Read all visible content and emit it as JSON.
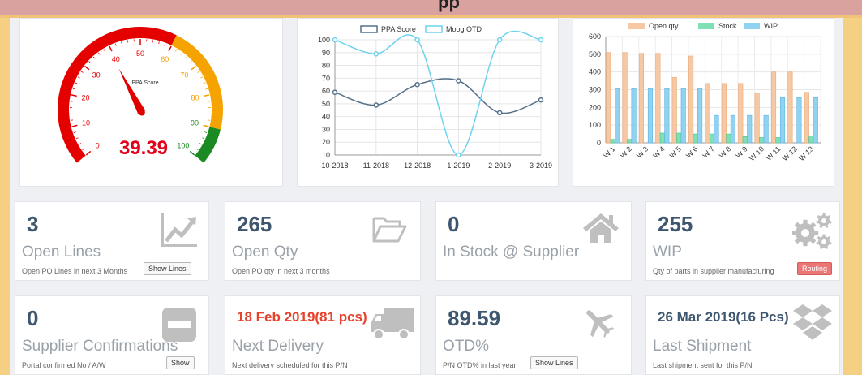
{
  "header": {
    "title": "pp"
  },
  "gauge": {
    "value": "39.39",
    "label": "PPA Score",
    "ticks": [
      "0",
      "10",
      "20",
      "30",
      "40",
      "50",
      "60",
      "70",
      "80",
      "90",
      "100"
    ]
  },
  "line_chart": {
    "legend": [
      "PPA Score",
      "Moog OTD"
    ],
    "yticks": [
      "100",
      "90",
      "80",
      "70",
      "60",
      "50",
      "40",
      "30",
      "20",
      "10"
    ],
    "xticks": [
      "10-2018",
      "11-2018",
      "12-2018",
      "1-2019",
      "2-2019",
      "3-2019"
    ]
  },
  "bar_chart": {
    "legend": [
      "Open qty",
      "Stock",
      "WIP"
    ],
    "yticks": [
      "600",
      "500",
      "400",
      "300",
      "200",
      "100",
      "0"
    ],
    "xticks": [
      "W 1",
      "W 2",
      "W 3",
      "W 4",
      "W 5",
      "W 6",
      "W 7",
      "W 8",
      "W 9",
      "W 10",
      "W 11",
      "W 12",
      "W 13"
    ]
  },
  "chart_data": [
    {
      "type": "gauge",
      "title": "PPA Score",
      "value": 39.39,
      "range": [
        0,
        100
      ],
      "bands": [
        {
          "from": 0,
          "to": 60,
          "color": "#e50000"
        },
        {
          "from": 60,
          "to": 90,
          "color": "#f5a300"
        },
        {
          "from": 90,
          "to": 100,
          "color": "#1b8a23"
        }
      ]
    },
    {
      "type": "line",
      "categories": [
        "10-2018",
        "11-2018",
        "12-2018",
        "1-2019",
        "2-2019",
        "3-2019"
      ],
      "series": [
        {
          "name": "PPA Score",
          "color": "#56708a",
          "values": [
            59,
            49,
            65,
            68,
            43,
            53
          ]
        },
        {
          "name": "Moog OTD",
          "color": "#6dd3ee",
          "values": [
            100,
            89,
            100,
            10,
            100,
            100
          ]
        }
      ],
      "ylim": [
        10,
        100
      ],
      "grid": true,
      "legend": "top"
    },
    {
      "type": "bar",
      "categories": [
        "W 1",
        "W 2",
        "W 3",
        "W 4",
        "W 5",
        "W 6",
        "W 7",
        "W 8",
        "W 9",
        "W 10",
        "W 11",
        "W 12",
        "W 13"
      ],
      "series": [
        {
          "name": "Open qty",
          "color": "#f6c9a4",
          "values": [
            510,
            510,
            505,
            505,
            370,
            490,
            335,
            335,
            335,
            280,
            400,
            400,
            285
          ]
        },
        {
          "name": "Stock",
          "color": "#7fe0b6",
          "values": [
            20,
            20,
            0,
            55,
            55,
            50,
            50,
            50,
            35,
            30,
            30,
            0,
            40
          ]
        },
        {
          "name": "WIP",
          "color": "#92d2f1",
          "values": [
            305,
            305,
            305,
            305,
            305,
            305,
            155,
            155,
            155,
            155,
            255,
            255,
            255
          ]
        }
      ],
      "ylim": [
        0,
        600
      ],
      "grid": true,
      "legend": "top"
    }
  ],
  "kpis": [
    {
      "value": "3",
      "label": "Open Lines",
      "sub": "Open PO Lines in next 3 Months",
      "button": "Show Lines",
      "icon": "line-chart-icon"
    },
    {
      "value": "265",
      "label": "Open Qty",
      "sub": "Open PO qty in next 3 months",
      "icon": "folder-open-icon"
    },
    {
      "value": "0",
      "label": "In Stock @ Supplier",
      "icon": "home-icon"
    },
    {
      "value": "255",
      "label": "WIP",
      "sub": "Qty of parts in supplier manufacturing",
      "button": "Routing",
      "icon": "gears-icon"
    },
    {
      "value": "0",
      "label": "Supplier Confirmations",
      "sub": "Portal confirmed No / A/W",
      "button": "Show",
      "icon": "minus-square-icon"
    },
    {
      "value": "18 Feb 2019(81 pcs)",
      "label": "Next Delivery",
      "sub": "Next delivery scheduled for this P/N",
      "icon": "truck-icon"
    },
    {
      "value": "89.59",
      "label": "OTD%",
      "sub": "P/N OTD% in last year",
      "button": "Show Lines",
      "icon": "plane-icon"
    },
    {
      "value": "26 Mar 2019(16 Pcs)",
      "label": "Last Shipment",
      "sub": "Last shipment sent for this P/N",
      "icon": "dropbox-icon"
    }
  ]
}
